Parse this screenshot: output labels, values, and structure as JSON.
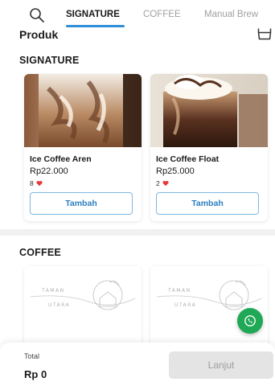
{
  "tabs": [
    {
      "label": "SIGNATURE",
      "active": true
    },
    {
      "label": "COFFEE",
      "active": false
    },
    {
      "label": "Manual Brew",
      "active": false
    }
  ],
  "header": {
    "title": "Produk"
  },
  "sections": [
    {
      "title": "SIGNATURE",
      "products": [
        {
          "name": "Ice Coffee Aren",
          "price": "Rp22.000",
          "likes": "8",
          "button_label": "Tambah"
        },
        {
          "name": "Ice Coffee Float",
          "price": "Rp25.000",
          "likes": "2",
          "button_label": "Tambah"
        }
      ]
    },
    {
      "title": "COFFEE",
      "logo_text": [
        "TAMAN",
        "UTARA"
      ]
    }
  ],
  "footer": {
    "total_label": "Total",
    "total_value": "Rp 0",
    "next_label": "Lanjut"
  },
  "colors": {
    "accent": "#2f8fd8",
    "whatsapp": "#1fa855",
    "heart": "#e53935",
    "disabled": "#e4e4e4"
  },
  "icons": [
    "search-icon",
    "cart-icon",
    "heart-icon",
    "whatsapp-icon"
  ]
}
